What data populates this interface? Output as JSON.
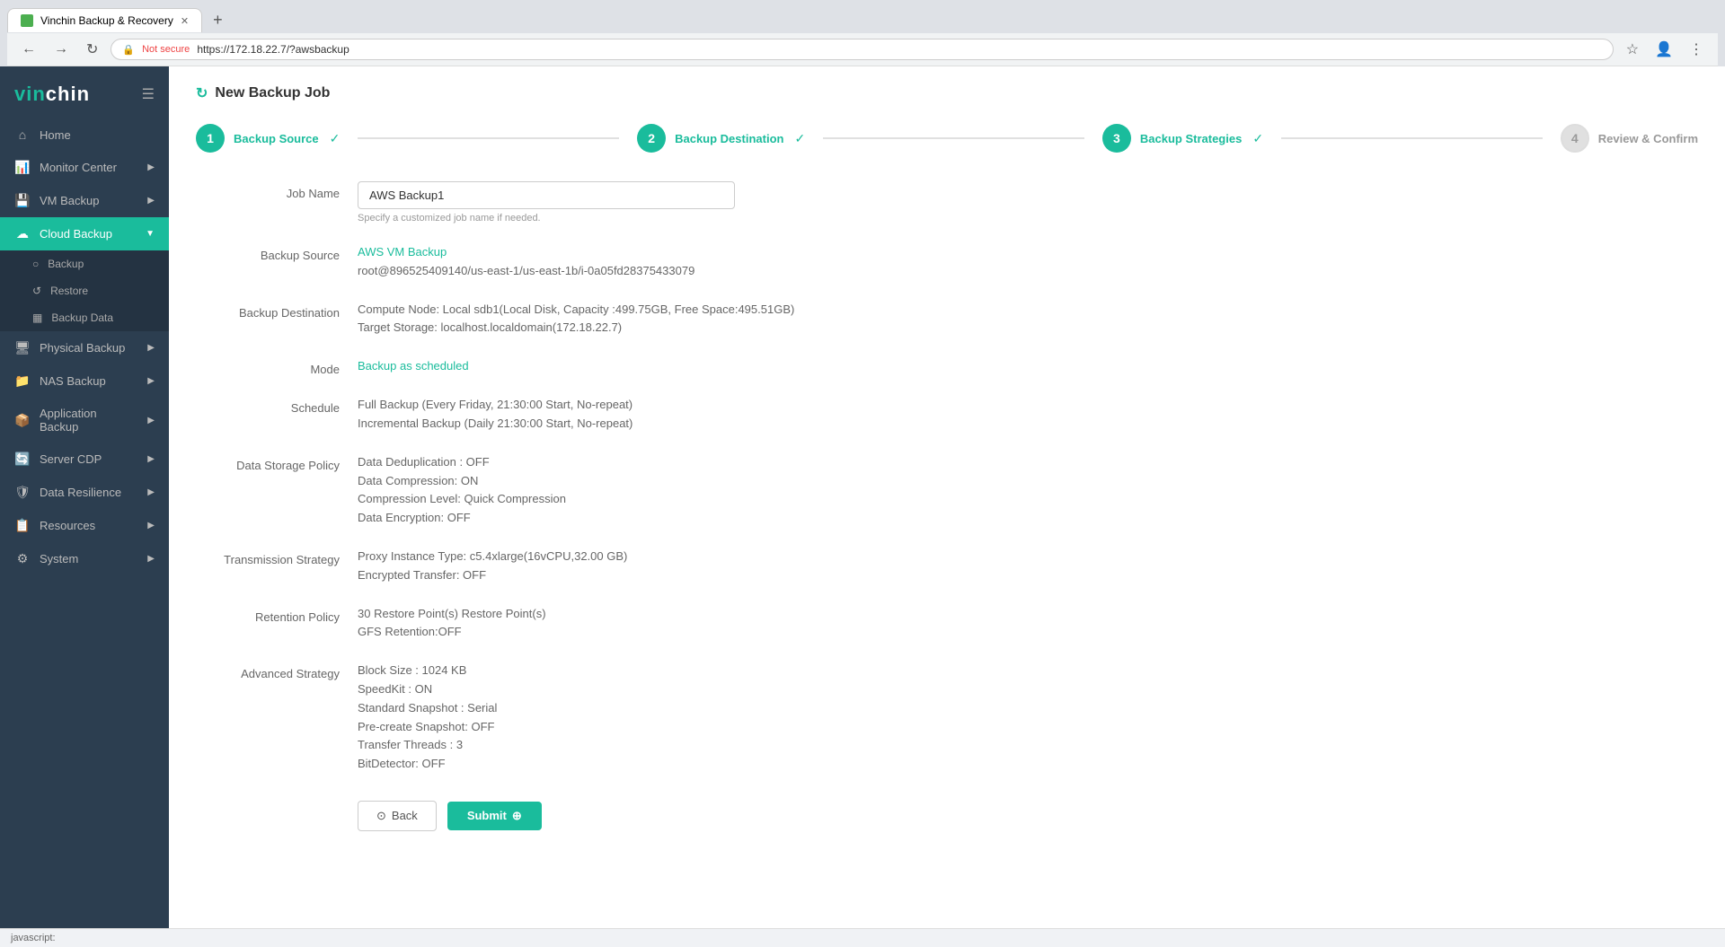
{
  "browser": {
    "tab_title": "Vinchin Backup & Recovery",
    "url": "https://172.18.22.7/?awsbackup",
    "not_secure_label": "Not secure",
    "new_tab_label": "+"
  },
  "sidebar": {
    "logo": "vinchin",
    "items": [
      {
        "id": "home",
        "label": "Home",
        "icon": "⌂",
        "active": false
      },
      {
        "id": "monitor-center",
        "label": "Monitor Center",
        "icon": "📊",
        "active": false,
        "has_arrow": true
      },
      {
        "id": "vm-backup",
        "label": "VM Backup",
        "icon": "💾",
        "active": false,
        "has_arrow": true
      },
      {
        "id": "cloud-backup",
        "label": "Cloud Backup",
        "icon": "☁",
        "active": true,
        "has_arrow": true
      },
      {
        "id": "physical-backup",
        "label": "Physical Backup",
        "icon": "🖥",
        "active": false,
        "has_arrow": true
      },
      {
        "id": "nas-backup",
        "label": "NAS Backup",
        "icon": "📁",
        "active": false,
        "has_arrow": true
      },
      {
        "id": "application-backup",
        "label": "Application Backup",
        "icon": "📦",
        "active": false,
        "has_arrow": true
      },
      {
        "id": "server-cdp",
        "label": "Server CDP",
        "icon": "🔄",
        "active": false,
        "has_arrow": true
      },
      {
        "id": "data-resilience",
        "label": "Data Resilience",
        "icon": "🛡",
        "active": false,
        "has_arrow": true
      },
      {
        "id": "resources",
        "label": "Resources",
        "icon": "📋",
        "active": false,
        "has_arrow": true
      },
      {
        "id": "system",
        "label": "System",
        "icon": "⚙",
        "active": false,
        "has_arrow": true
      }
    ],
    "sub_items": [
      {
        "id": "backup",
        "label": "Backup",
        "icon": "○",
        "active": false
      },
      {
        "id": "restore",
        "label": "Restore",
        "icon": "↺",
        "active": false
      },
      {
        "id": "backup-data",
        "label": "Backup Data",
        "icon": "▦",
        "active": false
      }
    ]
  },
  "page": {
    "title": "New Backup Job",
    "refresh_icon": "↻"
  },
  "stepper": {
    "steps": [
      {
        "number": "1",
        "label": "Backup Source",
        "state": "done",
        "check": "✓"
      },
      {
        "number": "2",
        "label": "Backup Destination",
        "state": "done",
        "check": "✓"
      },
      {
        "number": "3",
        "label": "Backup Strategies",
        "state": "done",
        "check": "✓"
      },
      {
        "number": "4",
        "label": "Review & Confirm",
        "state": "inactive"
      }
    ]
  },
  "form": {
    "job_name_label": "Job Name",
    "job_name_value": "AWS Backup1",
    "job_name_hint": "Specify a customized job name if needed.",
    "backup_source_label": "Backup Source",
    "backup_source_line1": "AWS VM Backup",
    "backup_source_line2": "root@896525409140/us-east-1/us-east-1b/i-0a05fd28375433079",
    "backup_destination_label": "Backup Destination",
    "backup_destination_line1": "Compute Node: Local sdb1(Local Disk, Capacity :499.75GB, Free Space:495.51GB)",
    "backup_destination_line2": "Target Storage: localhost.localdomain(172.18.22.7)",
    "mode_label": "Mode",
    "mode_value": "Backup as scheduled",
    "schedule_label": "Schedule",
    "schedule_line1": "Full Backup (Every Friday, 21:30:00 Start, No-repeat)",
    "schedule_line2": "Incremental Backup (Daily 21:30:00 Start, No-repeat)",
    "data_storage_policy_label": "Data Storage Policy",
    "data_storage_line1": "Data Deduplication : OFF",
    "data_storage_line2": "Data Compression: ON",
    "data_storage_line3": "Compression Level: Quick Compression",
    "data_storage_line4": "Data Encryption: OFF",
    "transmission_strategy_label": "Transmission Strategy",
    "transmission_line1": "Proxy Instance Type: c5.4xlarge(16vCPU,32.00 GB)",
    "transmission_line2": "Encrypted Transfer: OFF",
    "retention_policy_label": "Retention Policy",
    "retention_line1": "30 Restore Point(s) Restore Point(s)",
    "retention_line2": "GFS Retention:OFF",
    "advanced_strategy_label": "Advanced Strategy",
    "advanced_line1": "Block Size : 1024 KB",
    "advanced_line2": "SpeedKit : ON",
    "advanced_line3": "Standard Snapshot : Serial",
    "advanced_line4": "Pre-create Snapshot: OFF",
    "advanced_line5": "Transfer Threads : 3",
    "advanced_line6": "BitDetector: OFF"
  },
  "buttons": {
    "back_label": "Back",
    "submit_label": "Submit"
  },
  "status_bar": {
    "text": "javascript:"
  }
}
